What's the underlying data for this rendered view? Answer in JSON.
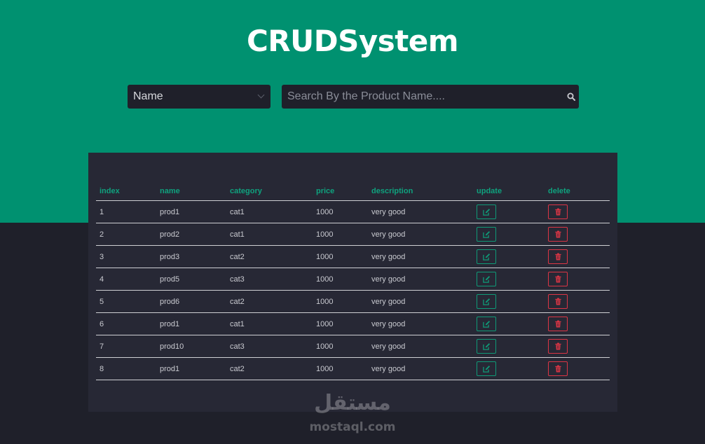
{
  "title": "CRUDSystem",
  "filter": {
    "selected": "Name"
  },
  "search": {
    "placeholder": "Search By the Product Name...."
  },
  "table": {
    "headers": [
      "index",
      "name",
      "category",
      "price",
      "description",
      "update",
      "delete"
    ],
    "rows": [
      {
        "index": "1",
        "name": "prod1",
        "category": "cat1",
        "price": "1000",
        "description": "very good"
      },
      {
        "index": "2",
        "name": "prod2",
        "category": "cat1",
        "price": "1000",
        "description": "very good"
      },
      {
        "index": "3",
        "name": "prod3",
        "category": "cat2",
        "price": "1000",
        "description": "very good"
      },
      {
        "index": "4",
        "name": "prod5",
        "category": "cat3",
        "price": "1000",
        "description": "very good"
      },
      {
        "index": "5",
        "name": "prod6",
        "category": "cat2",
        "price": "1000",
        "description": "very good"
      },
      {
        "index": "6",
        "name": "prod1",
        "category": "cat1",
        "price": "1000",
        "description": "very good"
      },
      {
        "index": "7",
        "name": "prod10",
        "category": "cat3",
        "price": "1000",
        "description": "very good"
      },
      {
        "index": "8",
        "name": "prod1",
        "category": "cat2",
        "price": "1000",
        "description": "very good"
      }
    ]
  },
  "icons": {
    "update": "edit-icon",
    "delete": "trash-icon",
    "search": "search-icon",
    "select": "chevron-down-icon"
  },
  "watermark": {
    "arabic": "مستقل",
    "latin": "mostaql.com"
  },
  "colors": {
    "accent": "#009170",
    "background": "#1f202a",
    "panel": "#272835",
    "update": "#0f9a77",
    "delete": "#dc3545"
  }
}
